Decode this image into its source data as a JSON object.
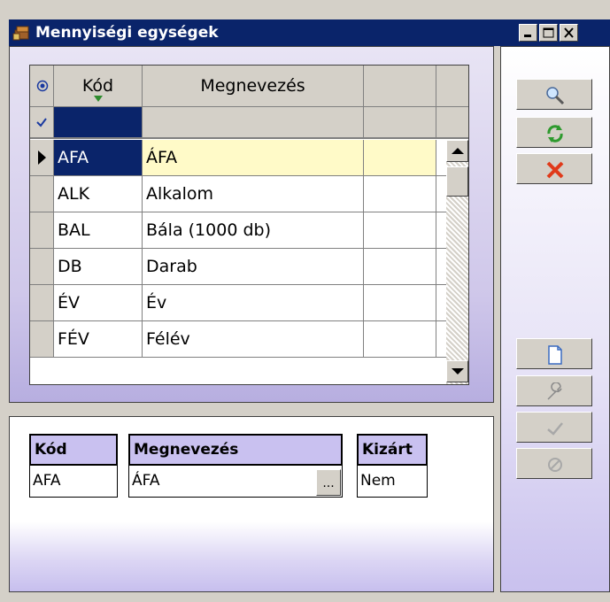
{
  "window": {
    "title": "Mennyiségi egységek",
    "title_bg": "#0a246a"
  },
  "grid": {
    "columns": [
      "Kód",
      "Megnevezés",
      ""
    ],
    "rows": [
      {
        "kod": "AFA",
        "nev": "ÁFA",
        "selected": true
      },
      {
        "kod": "ALK",
        "nev": "Alkalom"
      },
      {
        "kod": "BAL",
        "nev": "Bála (1000 db)"
      },
      {
        "kod": "DB",
        "nev": "Darab"
      },
      {
        "kod": "ÉV",
        "nev": "Év"
      },
      {
        "kod": "FÉV",
        "nev": "Félév"
      }
    ]
  },
  "form": {
    "kod_label": "Kód",
    "kod_value": "AFA",
    "megnevezes_label": "Megnevezés",
    "megnevezes_value": "ÁFA",
    "ellipsis_label": "...",
    "kizart_label": "Kizárt",
    "kizart_value": "Nem"
  },
  "toolbar": {
    "icons": [
      "search-icon",
      "refresh-icon",
      "delete-icon",
      "new-icon",
      "edit-icon",
      "confirm-icon",
      "cancel-icon"
    ]
  },
  "colors": {
    "panel_accent": "#c9c1f0",
    "selected_cell": "#0a246a",
    "selected_row": "#fffac8"
  }
}
